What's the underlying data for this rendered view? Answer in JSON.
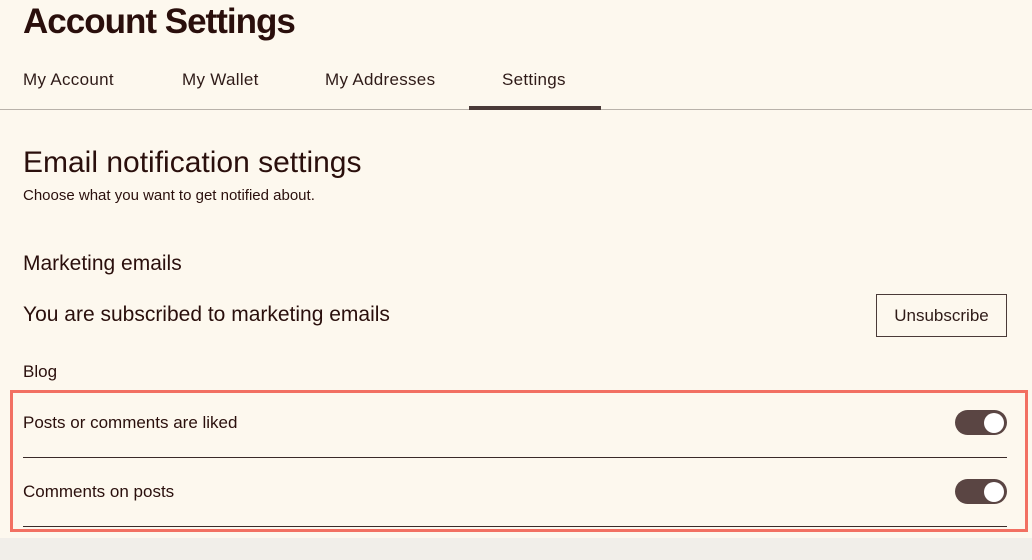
{
  "header": {
    "title": "Account Settings"
  },
  "tabs": [
    {
      "label": "My Account",
      "selected": false
    },
    {
      "label": "My Wallet",
      "selected": false
    },
    {
      "label": "My Addresses",
      "selected": false
    },
    {
      "label": "Settings",
      "selected": true
    }
  ],
  "email_settings": {
    "title": "Email notification settings",
    "subtitle": "Choose what you want to get notified about."
  },
  "marketing": {
    "title": "Marketing emails",
    "status_text": "You are subscribed to marketing emails",
    "unsubscribe_label": "Unsubscribe"
  },
  "blog": {
    "title": "Blog",
    "settings": [
      {
        "label": "Posts or comments are liked",
        "enabled": true
      },
      {
        "label": "Comments on posts",
        "enabled": true
      }
    ]
  },
  "colors": {
    "background": "#fdf8ee",
    "text": "#2a0f0c",
    "toggle_on": "#5a4543",
    "highlight": "#f27062"
  }
}
